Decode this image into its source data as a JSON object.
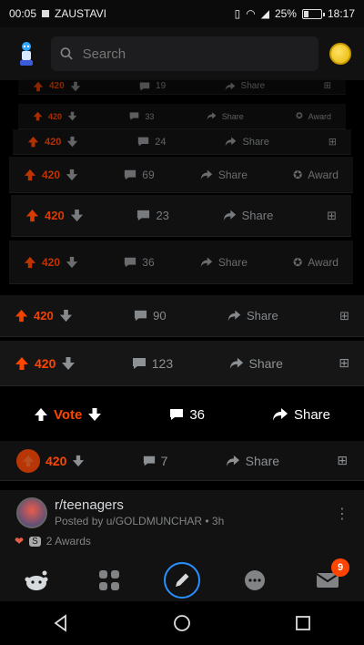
{
  "status_bar": {
    "clock_left": "00:05",
    "notification": "ZAUSTAVI",
    "battery": "25%",
    "clock_right": "18:17"
  },
  "header": {
    "search_placeholder": "Search"
  },
  "vote_bars": [
    {
      "score": "420",
      "comments": "19",
      "action": "Share"
    },
    {
      "score": "420",
      "comments": "33",
      "action": "Share",
      "extra": "Award"
    },
    {
      "score": "420",
      "comments": "24",
      "action": "Share"
    },
    {
      "score": "420",
      "comments": "69",
      "action": "Share",
      "extra": "Award"
    },
    {
      "score": "420",
      "comments": "23",
      "action": "Share"
    },
    {
      "score": "420",
      "comments": "36",
      "action": "Share",
      "extra": "Award"
    },
    {
      "score": "420",
      "comments": "90",
      "action": "Share"
    },
    {
      "score": "420",
      "comments": "123",
      "action": "Share"
    }
  ],
  "vote_row": {
    "label": "Vote",
    "comments": "36",
    "share": "Share"
  },
  "active_bar": {
    "score": "420",
    "comments": "7",
    "action": "Share"
  },
  "post": {
    "subreddit": "r/teenagers",
    "meta": "Posted by u/GOLDMUNCHAR • 3h",
    "awards": "2 Awards"
  },
  "tabs": {
    "inbox_badge": "9"
  },
  "colors": {
    "accent": "#ff4500",
    "background": "#000000"
  }
}
